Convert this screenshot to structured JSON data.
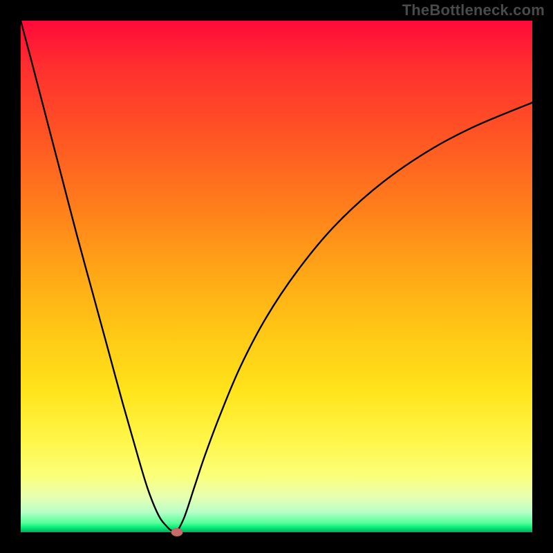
{
  "watermark": "TheBottleneck.com",
  "chart_data": {
    "type": "line",
    "title": "",
    "xlabel": "",
    "ylabel": "",
    "xlim": [
      0,
      100
    ],
    "ylim": [
      0,
      100
    ],
    "grid": false,
    "legend": false,
    "series": [
      {
        "name": "left-branch",
        "x": [
          0,
          2,
          5,
          8,
          11,
          14,
          17,
          20,
          23,
          25,
          27,
          28.5,
          29.5,
          30.5
        ],
        "y": [
          100,
          92.5,
          81,
          69.5,
          58,
          47,
          36,
          25,
          14.5,
          8,
          3.2,
          1.2,
          0.3,
          0
        ]
      },
      {
        "name": "right-branch",
        "x": [
          30.5,
          32,
          34,
          36,
          39,
          43,
          48,
          54,
          61,
          69,
          78,
          88,
          100
        ],
        "y": [
          0,
          3,
          9,
          15,
          23,
          32.5,
          42,
          51,
          59.5,
          67,
          73.5,
          79,
          84
        ]
      }
    ],
    "marker": {
      "x": 30.5,
      "y": 0
    },
    "background_gradient": {
      "top": "#ff0a3a",
      "mid": "#ffd21a",
      "bottom": "#05c96a"
    },
    "curve_color": "#000000",
    "marker_color": "#c76a6a"
  }
}
